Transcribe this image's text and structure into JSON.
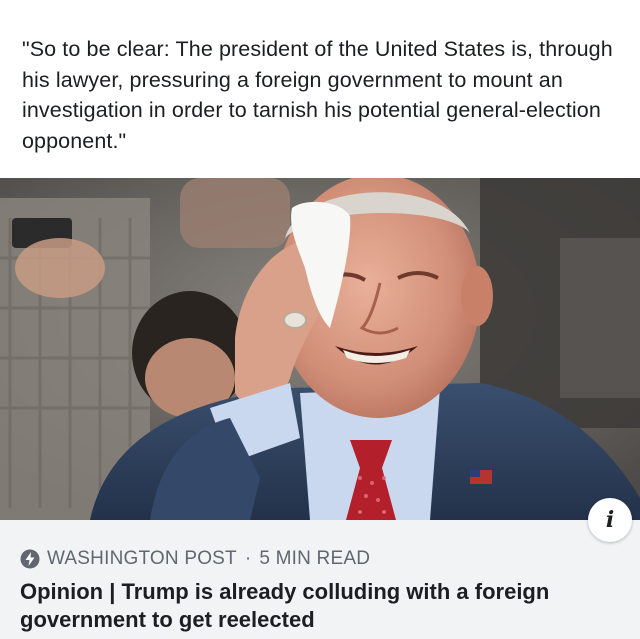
{
  "post": {
    "quote": "\"So to be clear: The president of the United States is, through his lawyer, pressuring a foreign government to mount an investigation in order to tarnish his potential general-election opponent.\""
  },
  "link_card": {
    "source": "WASHINGTON POST",
    "separator": "·",
    "read_time": "5 MIN READ",
    "headline": "Opinion | Trump is already colluding with a foreign government to get reelected",
    "info_glyph": "i",
    "source_icon": "lightning-bolt-icon",
    "info_icon": "info-icon"
  },
  "colors": {
    "text_primary": "#1c1e21",
    "text_secondary": "#606770",
    "card_bg": "#f2f3f5"
  }
}
